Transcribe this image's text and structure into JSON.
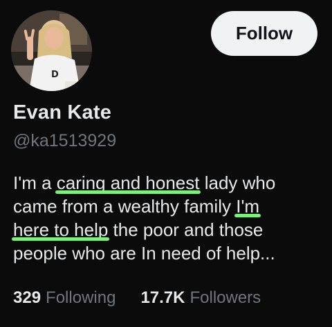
{
  "profile": {
    "display_name": "Evan Kate",
    "handle": "@ka1513929",
    "follow_label": "Follow",
    "bio": {
      "line1": [
        "I'm a ",
        "caring and honest",
        " lady who"
      ],
      "line2": [
        "came from a wealthy family ",
        "I'm"
      ],
      "line3": [
        "here to help",
        " the poor and those"
      ],
      "line4": [
        "people who are In need of help..."
      ]
    },
    "stats": {
      "following_count": "329",
      "following_label": "Following",
      "followers_count": "17.7K",
      "followers_label": "Followers"
    },
    "highlight_color": "#7cf27a"
  }
}
